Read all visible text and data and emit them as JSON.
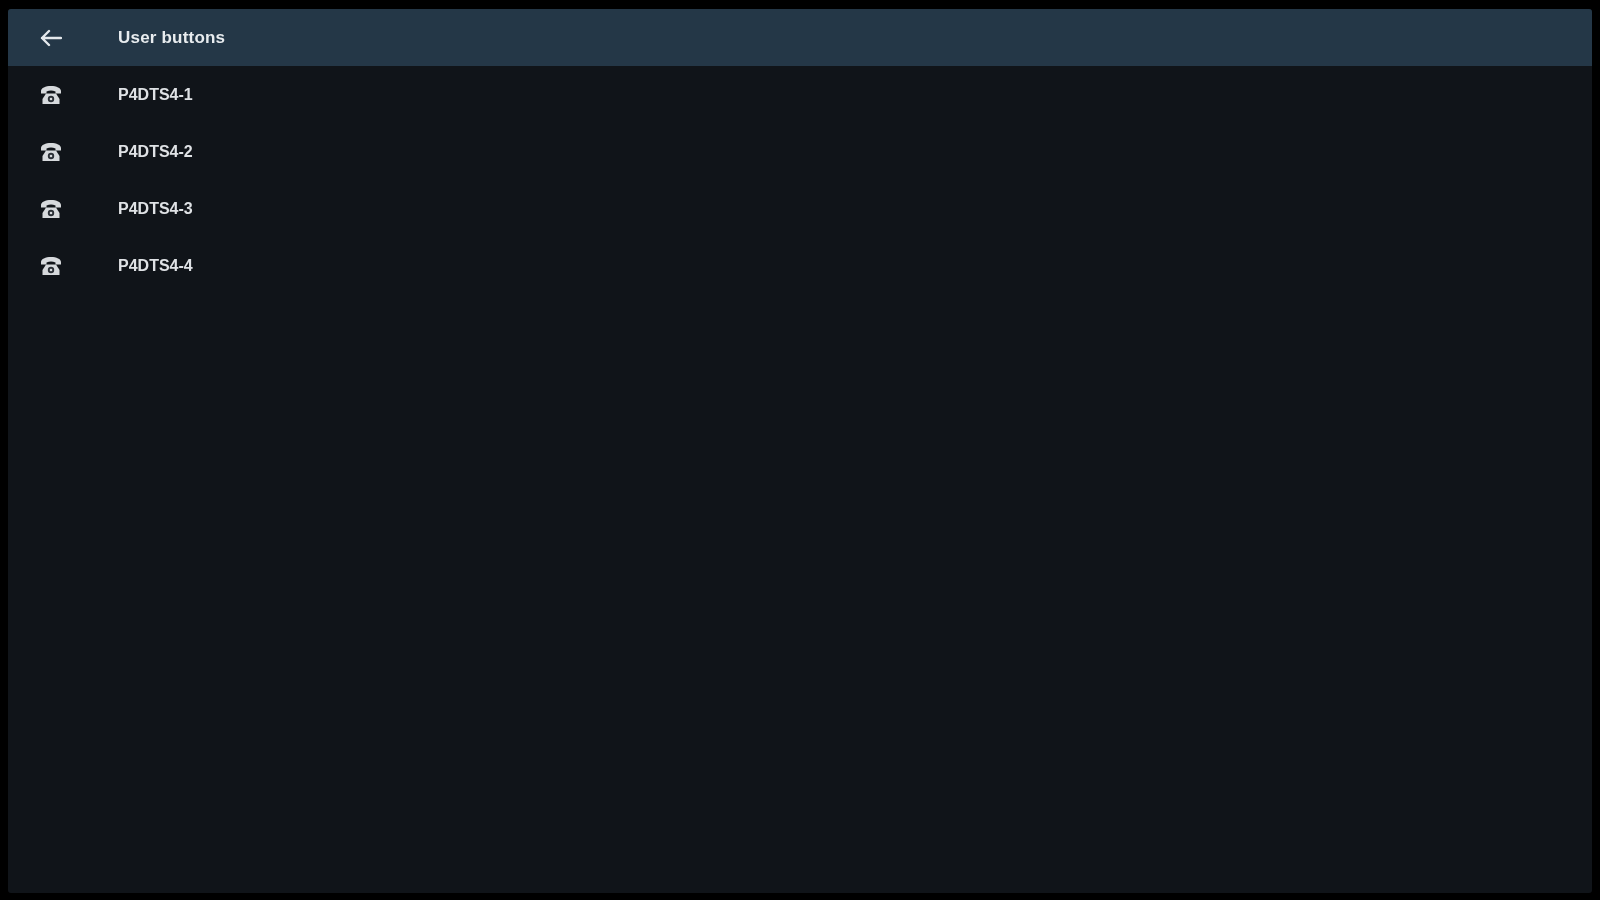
{
  "header": {
    "title": "User buttons"
  },
  "items": [
    {
      "label": "P4DTS4-1"
    },
    {
      "label": "P4DTS4-2"
    },
    {
      "label": "P4DTS4-3"
    },
    {
      "label": "P4DTS4-4"
    }
  ]
}
